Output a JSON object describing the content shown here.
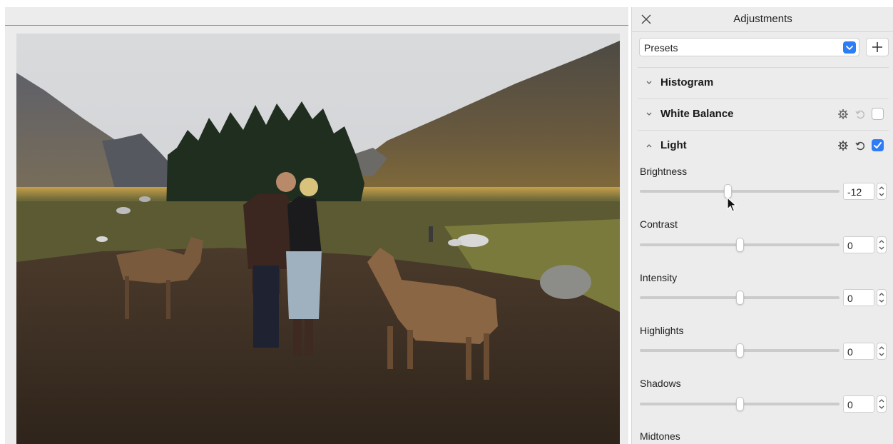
{
  "panel": {
    "title": "Adjustments",
    "presets_label": "Presets",
    "sections": [
      {
        "title": "Histogram",
        "expanded": false
      },
      {
        "title": "White Balance",
        "expanded": false,
        "enabled": false
      },
      {
        "title": "Light",
        "expanded": true,
        "enabled": true
      }
    ],
    "light": {
      "sliders": [
        {
          "label": "Brightness",
          "value": "-12",
          "level": -12
        },
        {
          "label": "Contrast",
          "value": "0",
          "level": 0
        },
        {
          "label": "Intensity",
          "value": "0",
          "level": 0
        },
        {
          "label": "Highlights",
          "value": "0",
          "level": 0
        },
        {
          "label": "Shadows",
          "value": "0",
          "level": 0
        }
      ],
      "partial_label": "Midtones"
    }
  },
  "colors": {
    "accent": "#2f7df6",
    "panel_bg": "#ececec",
    "canvas_line": "#4aa3d8"
  },
  "icons": [
    "close-icon",
    "chevron-down-icon",
    "plus-icon",
    "chevron-right-icon",
    "gear-icon",
    "reset-icon",
    "checkbox-icon",
    "stepper-icon",
    "pointer-cursor-icon"
  ]
}
